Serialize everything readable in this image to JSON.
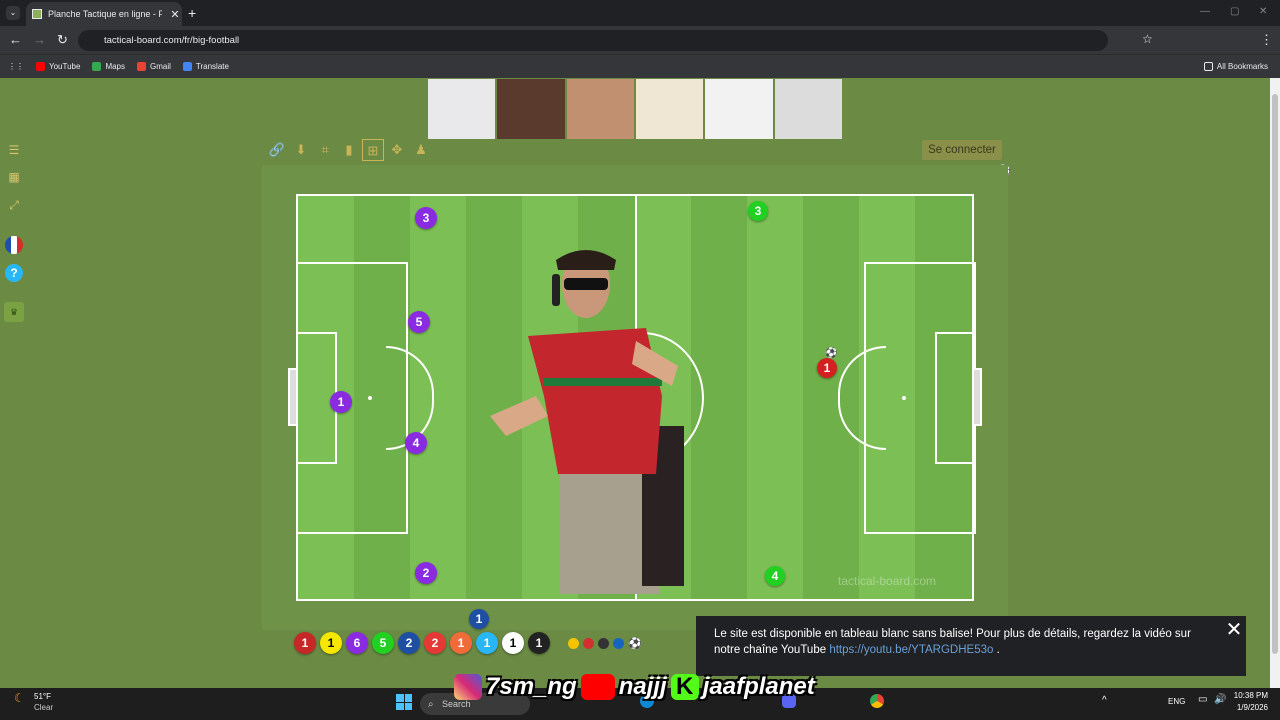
{
  "browser": {
    "tab_title": "Planche Tactique en ligne - Foo",
    "tab_close": "✕",
    "new_tab": "+",
    "url": "tactical-board.com/fr/big-football",
    "bookmarks": [
      {
        "label": "YouTube",
        "color": "#ff0000"
      },
      {
        "label": "Maps",
        "color": "#34a853"
      },
      {
        "label": "Gmail",
        "color": "#ea4335"
      },
      {
        "label": "Translate",
        "color": "#4285f4"
      }
    ],
    "all_bookmarks": "All Bookmarks"
  },
  "page": {
    "login_label": "Se connecter",
    "watermark": "tactical-board.com",
    "notice": {
      "text": "Le site est disponible en tableau blanc sans balise! Pour plus de détails, regardez la vidéo sur notre chaîne YouTube",
      "link": "https://youtu.be/YTARGDHE53o",
      "tail": ".",
      "close": "✕"
    }
  },
  "players": {
    "purple": [
      "3",
      "5",
      "1",
      "4",
      "2"
    ],
    "green": [
      "3",
      "4"
    ],
    "red": [
      "1"
    ]
  },
  "palette": {
    "above_chip": "1",
    "chips": [
      {
        "label": "1",
        "bg": "#c62828",
        "fg": "#ffffff"
      },
      {
        "label": "1",
        "bg": "#f5e700",
        "fg": "#000000"
      },
      {
        "label": "6",
        "bg": "#8a2be2",
        "fg": "#ffffff"
      },
      {
        "label": "5",
        "bg": "#22d022",
        "fg": "#ffffff"
      },
      {
        "label": "2",
        "bg": "#1e4fa3",
        "fg": "#ffffff"
      },
      {
        "label": "2",
        "bg": "#e53935",
        "fg": "#ffffff"
      },
      {
        "label": "1",
        "bg": "#f06b3a",
        "fg": "#ffffff"
      },
      {
        "label": "1",
        "bg": "#29b6f6",
        "fg": "#ffffff"
      },
      {
        "label": "1",
        "bg": "#ffffff",
        "fg": "#000000"
      },
      {
        "label": "1",
        "bg": "#222222",
        "fg": "#ffffff"
      }
    ],
    "dots": [
      "#f5c400",
      "#d32f2f",
      "#333333",
      "#1565c0"
    ]
  },
  "overlay": {
    "instagram": "7sm_ng",
    "youtube": "najjj",
    "kick": "jaafplanet"
  },
  "taskbar": {
    "weather_temp": "51°F",
    "weather_desc": "Clear",
    "search": "Search",
    "lang": "ENG",
    "time": "10:38 PM",
    "date": "1/9/2026"
  }
}
